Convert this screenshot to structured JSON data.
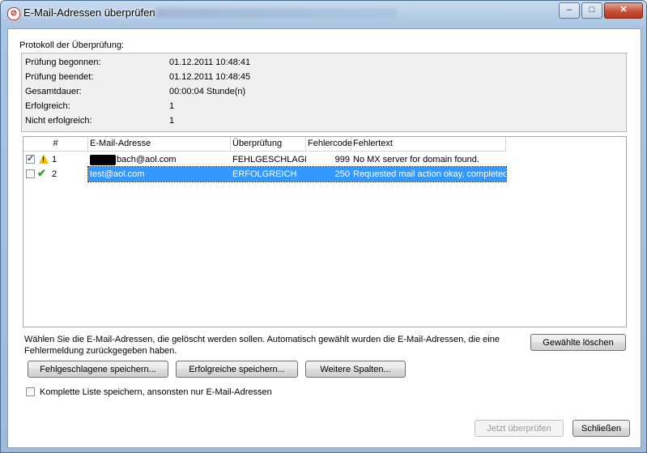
{
  "window": {
    "title": "E-Mail-Adressen überprüfen",
    "title_icon": "no-entry-icon",
    "controls": {
      "minimize": "–",
      "maximize": "□",
      "close": "✕"
    }
  },
  "protocol": {
    "label": "Protokoll der Überprüfung:",
    "rows": [
      {
        "label": "Prüfung begonnen:",
        "value": "01.12.2011 10:48:41"
      },
      {
        "label": "Prüfung beendet:",
        "value": "01.12.2011 10:48:45"
      },
      {
        "label": "Gesamtdauer:",
        "value": "00:00:04 Stunde(n)"
      },
      {
        "label": "Erfolgreich:",
        "value": "1"
      },
      {
        "label": "Nicht erfolgreich:",
        "value": "1"
      }
    ]
  },
  "table": {
    "columns": [
      "#",
      "E-Mail-Adresse",
      "Überprüfung",
      "Fehlercode",
      "Fehlertext"
    ],
    "rows": [
      {
        "checked": true,
        "status_icon": "warning-icon",
        "num": "1",
        "email": "bach@aol.com",
        "email_redacted": true,
        "check": "FEHLGESCHLAGEN",
        "code": "999",
        "text": "No MX server for domain found.",
        "selected": false
      },
      {
        "checked": false,
        "status_icon": "checkmark-icon",
        "num": "2",
        "email": "test@aol.com",
        "email_redacted": false,
        "check": "ERFOLGREICH",
        "code": "250",
        "text": "Requested mail action okay, completed",
        "selected": true
      }
    ]
  },
  "hint": "Wählen Sie die E-Mail-Adressen, die gelöscht werden sollen. Automatisch gewählt wurden die E-Mail-Adressen, die eine Fehlermeldung zurückgegeben haben.",
  "buttons": {
    "delete_selected": "Gewählte löschen",
    "save_failed": "Fehlgeschlagene speichern...",
    "save_successful": "Erfolgreiche speichern...",
    "more_columns": "Weitere Spalten...",
    "check_now": "Jetzt überprüfen",
    "close": "Schließen"
  },
  "save_full_list": {
    "label": "Komplette Liste speichern, ansonsten nur E-Mail-Adressen",
    "checked": false
  },
  "colors": {
    "selection": "#3399ff",
    "close_button": "#c7513a",
    "warning": "#f2c500",
    "success": "#2e9e2e"
  }
}
